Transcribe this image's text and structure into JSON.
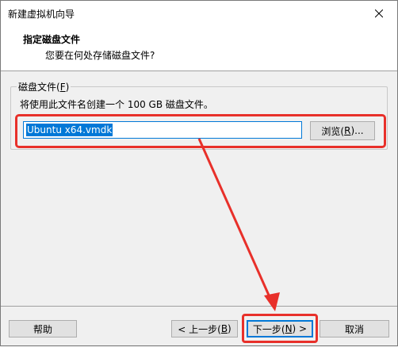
{
  "window": {
    "title": "新建虚拟机向导"
  },
  "header": {
    "title": "指定磁盘文件",
    "subtitle": "您要在何处存储磁盘文件?"
  },
  "group": {
    "legend_prefix": "磁盘文件(",
    "legend_key": "F",
    "legend_suffix": ")",
    "description": "将使用此文件名创建一个 100 GB 磁盘文件。",
    "file_value": "Ubuntu x64.vmdk",
    "browse_prefix": "浏览(",
    "browse_key": "R",
    "browse_suffix": ")..."
  },
  "buttons": {
    "help": "帮助",
    "back_prefix": "< 上一步(",
    "back_key": "B",
    "back_suffix": ")",
    "next_prefix": "下一步(",
    "next_key": "N",
    "next_suffix": ") >",
    "cancel": "取消"
  },
  "icons": {
    "close": "close-icon"
  },
  "colors": {
    "accent": "#0078d7",
    "annotation_red": "#e8302a",
    "button_face": "#e1e1e1",
    "window_bg": "#f0f0f0"
  }
}
